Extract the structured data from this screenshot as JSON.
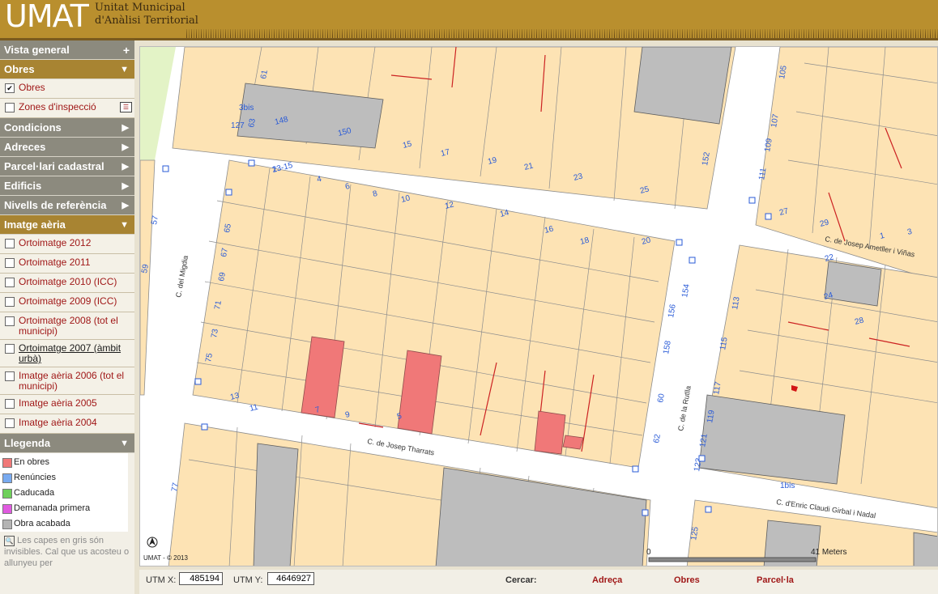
{
  "header": {
    "logo": "UMAT",
    "subtitle_line1": "Unitat Municipal",
    "subtitle_line2": "d'Anàlisi Territorial"
  },
  "sidebar": {
    "sections": [
      {
        "label": "Vista general",
        "state": "collapsed-plus"
      },
      {
        "label": "Obres",
        "state": "open"
      },
      {
        "label": "Condicions",
        "state": "closed"
      },
      {
        "label": "Adreces",
        "state": "closed"
      },
      {
        "label": "Parcel·lari cadastral",
        "state": "closed"
      },
      {
        "label": "Edificis",
        "state": "closed"
      },
      {
        "label": "Nivells de referència",
        "state": "closed"
      },
      {
        "label": "Imatge aèria",
        "state": "open"
      },
      {
        "label": "Llegenda",
        "state": "open"
      }
    ],
    "obres_items": [
      {
        "label": "Obres",
        "checked": true
      },
      {
        "label": "Zones d'inspecció",
        "checked": false
      }
    ],
    "aerial_items": [
      {
        "label": "Ortoimatge 2012"
      },
      {
        "label": "Ortoimatge 2011"
      },
      {
        "label": "Ortoimatge 2010 (ICC)"
      },
      {
        "label": "Ortoimatge 2009 (ICC)"
      },
      {
        "label": "Ortoimatge 2008 (tot el municipi)"
      },
      {
        "label": "Ortoimatge 2007 (àmbit urbà)"
      },
      {
        "label": "Imatge aèria 2006 (tot el municipi)"
      },
      {
        "label": "Imatge aèria 2005"
      },
      {
        "label": "Imatge aèria 2004"
      }
    ],
    "legend": [
      {
        "label": "En obres",
        "color": "#f07878"
      },
      {
        "label": "Renúncies",
        "color": "#78aaf0"
      },
      {
        "label": "Caducada",
        "color": "#6ed05a"
      },
      {
        "label": "Demanada primera ocupació",
        "color": "#e05ae0"
      },
      {
        "label": "Obra acabada",
        "color": "#b4b4b4"
      }
    ],
    "note": "Les capes en gris són invisibles. Cal que us acosteu o allunyeu per"
  },
  "map": {
    "copyright": "UMAT - © 2013",
    "scale_start": "0",
    "scale_end": "41 Meters",
    "streets": [
      "C. de Josep Tharrats",
      "C. del Migdia",
      "C. de la Rutlla",
      "C. de Josep Ametller i Viñas",
      "C. d'Enric Claudi Girbal i Nadal"
    ],
    "numbers": [
      "2",
      "4",
      "6",
      "8",
      "10",
      "12",
      "14",
      "16",
      "18",
      "20",
      "22",
      "24",
      "28",
      "5",
      "7",
      "9",
      "11",
      "13",
      "15",
      "17",
      "19",
      "21",
      "23",
      "25",
      "27",
      "29",
      "1",
      "3",
      "148",
      "150",
      "152",
      "154",
      "156",
      "158",
      "60",
      "62",
      "57",
      "59",
      "61",
      "63",
      "65",
      "67",
      "69",
      "71",
      "73",
      "75",
      "77",
      "105",
      "107",
      "109",
      "111",
      "113",
      "115",
      "117",
      "119",
      "121",
      "123",
      "125",
      "127",
      "3bis",
      "1bis",
      "13-15"
    ]
  },
  "bottom": {
    "utm_x_label": "UTM X:",
    "utm_x_value": "485194",
    "utm_y_label": "UTM Y:",
    "utm_y_value": "4646927",
    "search_label": "Cercar:",
    "links": [
      "Adreça",
      "Obres",
      "Parcel·la"
    ]
  }
}
